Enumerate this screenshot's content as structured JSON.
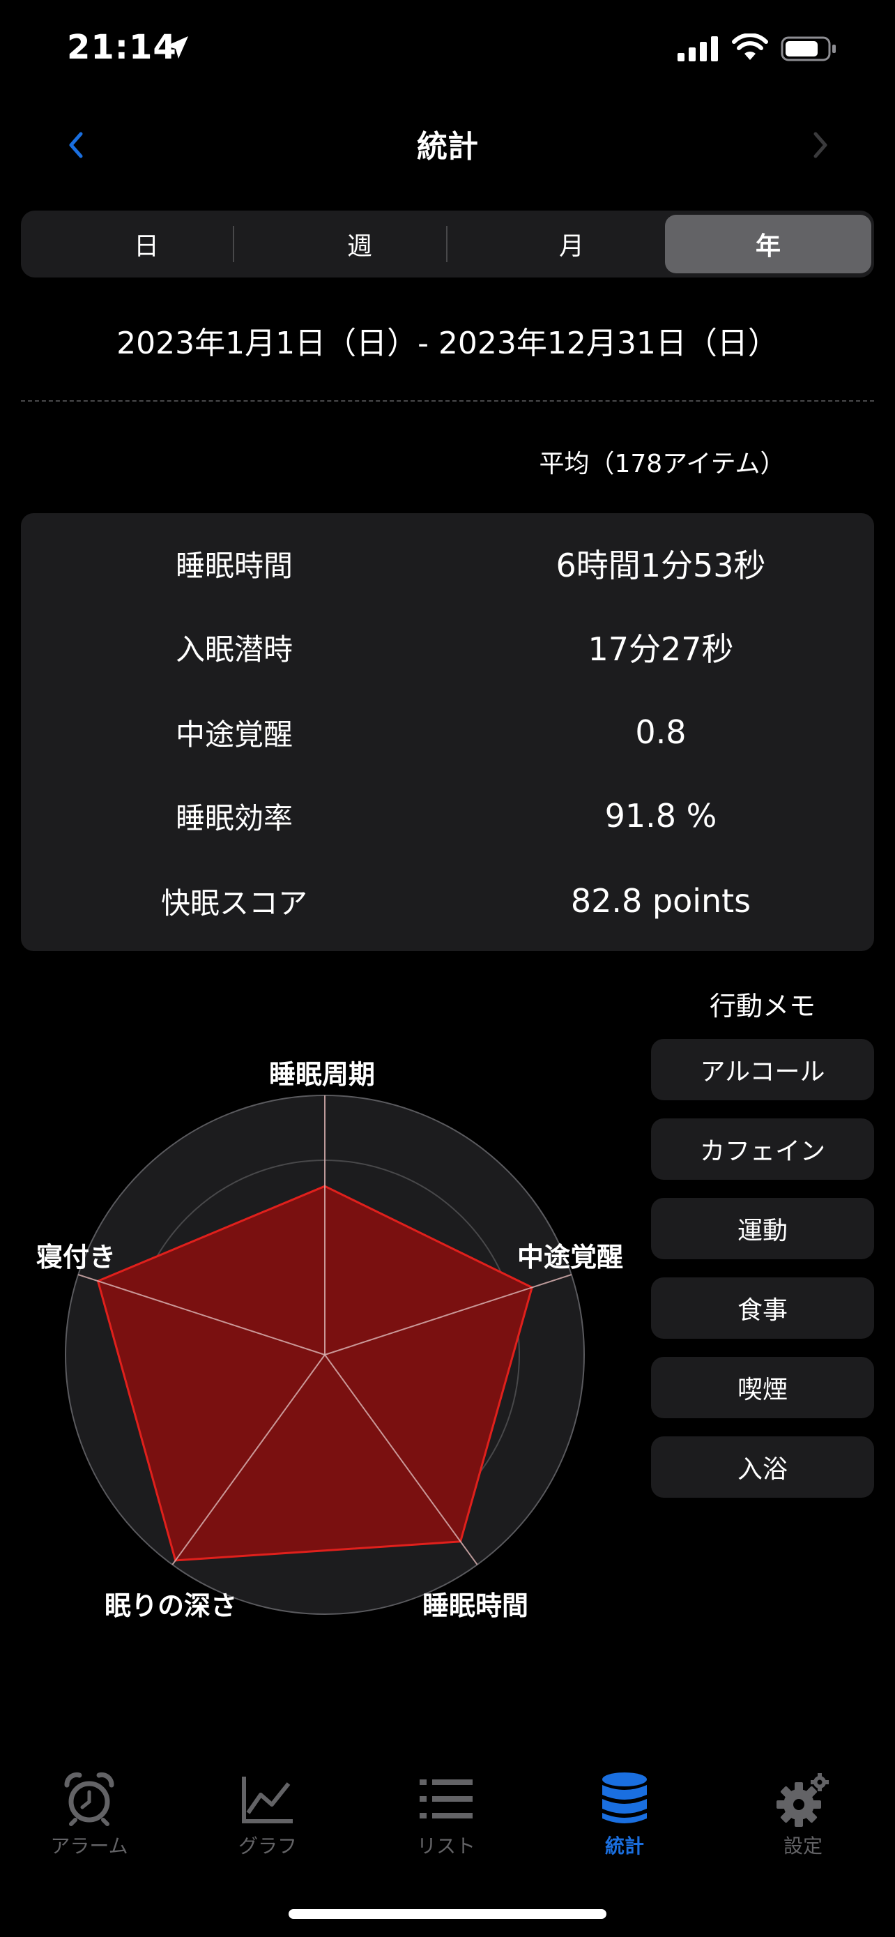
{
  "status_bar": {
    "time": "21:14"
  },
  "nav": {
    "title": "統計"
  },
  "segments": [
    {
      "label": "日",
      "selected": false
    },
    {
      "label": "週",
      "selected": false
    },
    {
      "label": "月",
      "selected": false
    },
    {
      "label": "年",
      "selected": true
    }
  ],
  "date_range": "2023年1月1日（日）- 2023年12月31日（日）",
  "average_label": "平均（178アイテム）",
  "stats": [
    {
      "key": "睡眠時間",
      "value": "6時間1分53秒"
    },
    {
      "key": "入眠潜時",
      "value": "17分27秒"
    },
    {
      "key": "中途覚醒",
      "value": "0.8"
    },
    {
      "key": "睡眠効率",
      "value": "91.8 %"
    },
    {
      "key": "快眠スコア",
      "value": "82.8 points"
    }
  ],
  "memo": {
    "title": "行動メモ",
    "items": [
      "アルコール",
      "カフェイン",
      "運動",
      "食事",
      "喫煙",
      "入浴"
    ]
  },
  "radar": {
    "axes": [
      {
        "label": "睡眠周期",
        "value": 0.65
      },
      {
        "label": "中途覚醒",
        "value": 0.84
      },
      {
        "label": "睡眠時間",
        "value": 0.89
      },
      {
        "label": "眠りの深さ",
        "value": 0.98
      },
      {
        "label": "寝付き",
        "value": 0.92
      }
    ],
    "colors": {
      "fill": "#7a1010",
      "stroke": "#e0201c",
      "bg": "#1c1c1e",
      "ring": "#48484a"
    }
  },
  "tabbar": [
    {
      "label": "アラーム",
      "icon": "alarm-clock-icon",
      "active": false
    },
    {
      "label": "グラフ",
      "icon": "chart-icon",
      "active": false
    },
    {
      "label": "リスト",
      "icon": "list-icon",
      "active": false
    },
    {
      "label": "統計",
      "icon": "database-icon",
      "active": true
    },
    {
      "label": "設定",
      "icon": "gear-icon",
      "active": false
    }
  ],
  "accent_color": "#1a6fe0"
}
